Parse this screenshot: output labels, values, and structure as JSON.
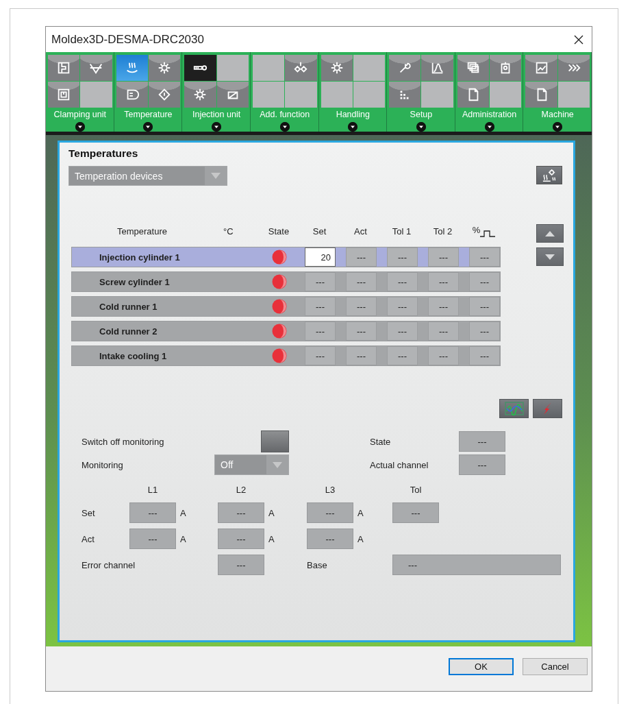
{
  "window": {
    "title": "Moldex3D-DESMA-DRC2030"
  },
  "toolbar": {
    "groups": [
      {
        "label": "Clamping unit",
        "tiles": [
          {
            "kind": "icon",
            "selected": false
          },
          {
            "kind": "icon",
            "selected": false
          },
          {
            "kind": "icon",
            "selected": false
          },
          {
            "kind": "blank",
            "selected": false
          }
        ]
      },
      {
        "label": "Temperature",
        "tiles": [
          {
            "kind": "icon",
            "selected": true
          },
          {
            "kind": "icon",
            "selected": false
          },
          {
            "kind": "icon",
            "selected": false
          },
          {
            "kind": "icon",
            "selected": false
          }
        ]
      },
      {
        "label": "Injection unit",
        "tiles": [
          {
            "kind": "dark",
            "selected": false
          },
          {
            "kind": "blank",
            "selected": false
          },
          {
            "kind": "icon",
            "selected": false
          },
          {
            "kind": "icon",
            "selected": false
          }
        ]
      },
      {
        "label": "Add. function",
        "tiles": [
          {
            "kind": "blank",
            "selected": false
          },
          {
            "kind": "icon",
            "selected": false
          },
          {
            "kind": "blank",
            "selected": false
          },
          {
            "kind": "blank",
            "selected": false
          }
        ]
      },
      {
        "label": "Handling",
        "tiles": [
          {
            "kind": "icon",
            "selected": false
          },
          {
            "kind": "blank",
            "selected": false
          },
          {
            "kind": "blank",
            "selected": false
          },
          {
            "kind": "blank",
            "selected": false
          }
        ]
      },
      {
        "label": "Setup",
        "tiles": [
          {
            "kind": "icon",
            "selected": false
          },
          {
            "kind": "icon",
            "selected": false
          },
          {
            "kind": "icon",
            "selected": false
          },
          {
            "kind": "blank",
            "selected": false
          }
        ]
      },
      {
        "label": "Administration",
        "tiles": [
          {
            "kind": "icon",
            "selected": false
          },
          {
            "kind": "icon",
            "selected": false
          },
          {
            "kind": "icon",
            "selected": false
          },
          {
            "kind": "blank",
            "selected": false
          }
        ]
      },
      {
        "label": "Machine",
        "tiles": [
          {
            "kind": "icon",
            "selected": false
          },
          {
            "kind": "icon",
            "selected": false
          },
          {
            "kind": "icon",
            "selected": false
          },
          {
            "kind": "blank",
            "selected": false
          }
        ]
      }
    ]
  },
  "panel": {
    "title": "Temperatures",
    "device_select": {
      "value": "Temperation devices",
      "disabled": true
    }
  },
  "table": {
    "columns": [
      "Temperature",
      "°C",
      "State",
      "Set",
      "Act",
      "Tol 1",
      "Tol 2",
      "%"
    ],
    "rows": [
      {
        "selected": true,
        "cells": [
          {
            "kind": "name",
            "value": "Injection cylinder 1"
          },
          {
            "kind": "empty"
          },
          {
            "kind": "status"
          },
          {
            "kind": "value",
            "value": "20",
            "editable": true
          },
          {
            "kind": "value",
            "value": "---",
            "editable": false
          },
          {
            "kind": "value",
            "value": "---",
            "editable": false
          },
          {
            "kind": "value",
            "value": "---",
            "editable": false
          },
          {
            "kind": "value",
            "value": "---",
            "editable": false
          }
        ]
      },
      {
        "selected": false,
        "cells": [
          {
            "kind": "name",
            "value": "Screw cylinder 1"
          },
          {
            "kind": "empty"
          },
          {
            "kind": "status"
          },
          {
            "kind": "value",
            "value": "---",
            "editable": false
          },
          {
            "kind": "value",
            "value": "---",
            "editable": false
          },
          {
            "kind": "value",
            "value": "---",
            "editable": false
          },
          {
            "kind": "value",
            "value": "---",
            "editable": false
          },
          {
            "kind": "value",
            "value": "---",
            "editable": false
          }
        ]
      },
      {
        "selected": false,
        "cells": [
          {
            "kind": "name",
            "value": "Cold runner 1"
          },
          {
            "kind": "empty"
          },
          {
            "kind": "status"
          },
          {
            "kind": "value",
            "value": "---",
            "editable": false
          },
          {
            "kind": "value",
            "value": "---",
            "editable": false
          },
          {
            "kind": "value",
            "value": "---",
            "editable": false
          },
          {
            "kind": "value",
            "value": "---",
            "editable": false
          },
          {
            "kind": "value",
            "value": "---",
            "editable": false
          }
        ]
      },
      {
        "selected": false,
        "cells": [
          {
            "kind": "name",
            "value": "Cold runner 2"
          },
          {
            "kind": "empty"
          },
          {
            "kind": "status"
          },
          {
            "kind": "value",
            "value": "---",
            "editable": false
          },
          {
            "kind": "value",
            "value": "---",
            "editable": false
          },
          {
            "kind": "value",
            "value": "---",
            "editable": false
          },
          {
            "kind": "value",
            "value": "---",
            "editable": false
          },
          {
            "kind": "value",
            "value": "---",
            "editable": false
          }
        ]
      },
      {
        "selected": false,
        "cells": [
          {
            "kind": "name",
            "value": "Intake cooling 1"
          },
          {
            "kind": "empty"
          },
          {
            "kind": "status"
          },
          {
            "kind": "value",
            "value": "---",
            "editable": false
          },
          {
            "kind": "value",
            "value": "---",
            "editable": false
          },
          {
            "kind": "value",
            "value": "---",
            "editable": false
          },
          {
            "kind": "value",
            "value": "---",
            "editable": false
          },
          {
            "kind": "value",
            "value": "---",
            "editable": false
          }
        ]
      }
    ]
  },
  "monitoring": {
    "switch_off_label": "Switch off monitoring",
    "monitoring_label": "Monitoring",
    "monitoring_select": {
      "value": "Off",
      "disabled": true
    },
    "state_label": "State",
    "state_value": "---",
    "actual_channel_label": "Actual channel",
    "actual_channel_value": "---",
    "phase_headers": [
      "L1",
      "L2",
      "L3",
      "Tol"
    ],
    "set_row": {
      "label": "Set",
      "cells": [
        {
          "value": "---",
          "unit": "A"
        },
        {
          "value": "---",
          "unit": "A"
        },
        {
          "value": "---",
          "unit": "A"
        },
        {
          "value": "---"
        }
      ]
    },
    "act_row": {
      "label": "Act",
      "cells": [
        {
          "value": "---",
          "unit": "A"
        },
        {
          "value": "---",
          "unit": "A"
        },
        {
          "value": "---",
          "unit": "A"
        }
      ]
    },
    "error_channel": {
      "label": "Error channel",
      "value": "---"
    },
    "base": {
      "label": "Base",
      "value": "---"
    }
  },
  "buttons": [
    {
      "label": "OK",
      "default": true
    },
    {
      "label": "Cancel",
      "default": false
    }
  ]
}
